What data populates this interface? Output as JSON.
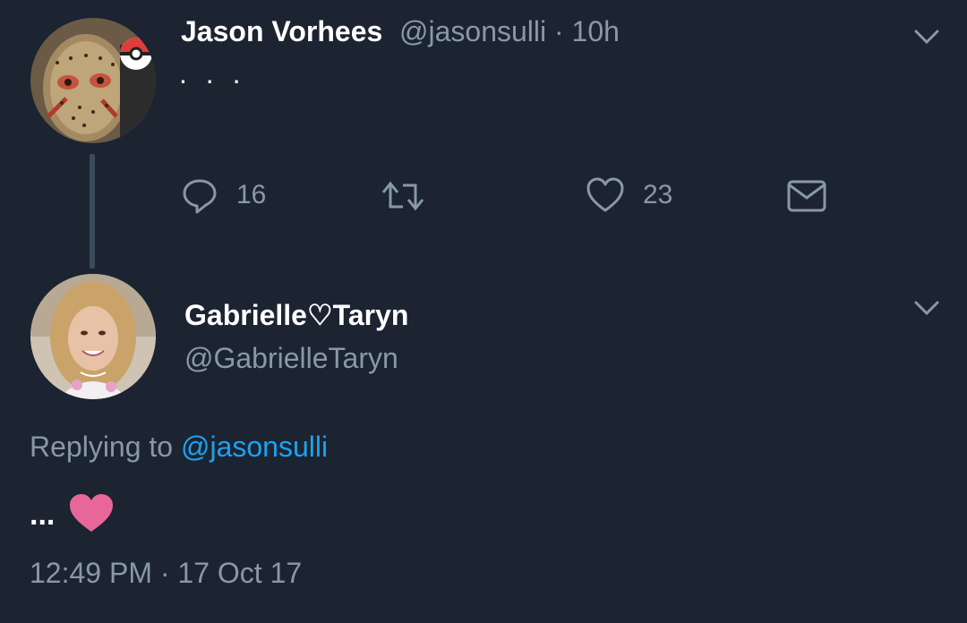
{
  "tweet": {
    "author_name": "Jason Vorhees",
    "author_handle": "@jasonsulli",
    "separator": "·",
    "time": "10h",
    "text": ". . .",
    "reply_count": "16",
    "like_count": "23"
  },
  "reply": {
    "author_name": "Gabrielle♡Taryn",
    "author_handle": "@GabrielleTaryn",
    "replying_prefix": "Replying to",
    "replying_handle": "@jasonsulli",
    "text": "...",
    "emoji": "❤",
    "timestamp": "12:49 PM · 17 Oct 17"
  },
  "colors": {
    "background": "#1b2430",
    "muted": "#8899a6",
    "link": "#1da1f2",
    "heart": "#e8669a"
  }
}
